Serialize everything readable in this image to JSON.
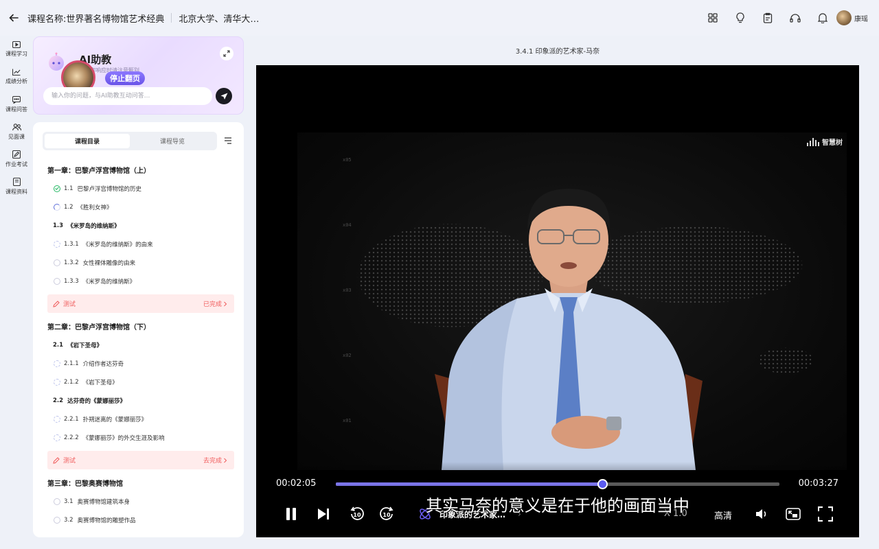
{
  "header": {
    "course_title": "课程名称:世界著名博物馆艺术经典",
    "course_school": "北京大学、清华大…",
    "user_name": "康瑶"
  },
  "nav": {
    "items": [
      {
        "label": "课程学习",
        "icon": "play-box-icon"
      },
      {
        "label": "成绩分析",
        "icon": "chart-icon"
      },
      {
        "label": "课程问答",
        "icon": "chat-icon"
      },
      {
        "label": "见面课",
        "icon": "people-icon"
      },
      {
        "label": "作业考试",
        "icon": "edit-icon"
      },
      {
        "label": "课程资料",
        "icon": "book-icon"
      }
    ]
  },
  "ai": {
    "title": "AI助教",
    "subtitle": "有内容响应时请注意甄别",
    "stop_label": "停止翻页",
    "input_placeholder": "输入你的问题，与AI助教互动问答..."
  },
  "catalog": {
    "tabs": [
      "课程目录",
      "课程导览"
    ],
    "chapter1": {
      "title": "第一章：巴黎卢浮宫博物馆（上）",
      "items": [
        {
          "num": "1.1",
          "label": "巴黎卢浮宫博物馆的历史",
          "status": "done"
        },
        {
          "num": "1.2",
          "label": "《胜利女神》",
          "status": "half"
        }
      ],
      "section": {
        "num": "1.3",
        "label": "《米罗岛的维纳斯》"
      },
      "subitems": [
        {
          "num": "1.3.1",
          "label": "《米罗岛的维纳斯》的由来",
          "status": "dash"
        },
        {
          "num": "1.3.2",
          "label": "女性裸体雕像的由来",
          "status": "empty"
        },
        {
          "num": "1.3.3",
          "label": "《米罗岛的维纳斯》",
          "status": "empty"
        }
      ],
      "quiz": {
        "label": "测试",
        "status": "已完成"
      }
    },
    "chapter2": {
      "title": "第二章：巴黎卢浮宫博物馆（下）",
      "section1": {
        "num": "2.1",
        "label": "《岩下圣母》"
      },
      "items1": [
        {
          "num": "2.1.1",
          "label": "介绍作者达芬奇",
          "status": "dash"
        },
        {
          "num": "2.1.2",
          "label": "《岩下圣母》",
          "status": "dash"
        }
      ],
      "section2": {
        "num": "2.2",
        "label": "达芬奇的《蒙娜丽莎》"
      },
      "items2": [
        {
          "num": "2.2.1",
          "label": "扑朔迷离的《蒙娜丽莎》",
          "status": "dash"
        },
        {
          "num": "2.2.2",
          "label": "《蒙娜丽莎》的外交生涯及影响",
          "status": "dash"
        }
      ],
      "quiz": {
        "label": "测试",
        "status": "去完成"
      }
    },
    "chapter3": {
      "title": "第三章：巴黎奥赛博物馆",
      "items": [
        {
          "num": "3.1",
          "label": "奥赛博物馆建筑本身",
          "status": "empty"
        },
        {
          "num": "3.2",
          "label": "奥赛博物馆的雕塑作品",
          "status": "empty"
        }
      ]
    }
  },
  "player": {
    "lesson_title": "3.4.1 印象派的艺术家-马奈",
    "watermark": "智慧树",
    "axis_ticks": [
      "x05",
      "x04",
      "x03",
      "x02",
      "x01"
    ],
    "subtitle": "其实马奈的意义是在于他的画面当中",
    "current_time": "00:02:05",
    "total_time": "00:03:27",
    "progress_fraction": 0.6,
    "buffer_fraction": 0.12,
    "chapter_label": "印象派的艺术家…",
    "speed": "X 1.0",
    "quality": "高清",
    "rewind_label": "10",
    "forward_label": "10"
  }
}
